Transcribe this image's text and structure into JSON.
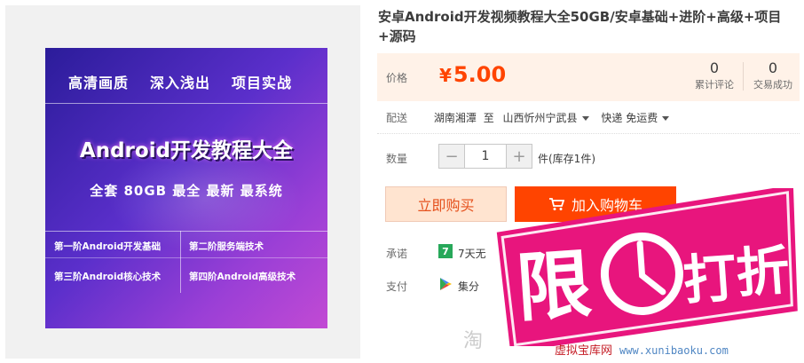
{
  "poster": {
    "tags": [
      "高清画质",
      "深入浅出",
      "项目实战"
    ],
    "title": "Android开发教程大全",
    "subtitle": "全套 80GB  最全 最新 最系统",
    "stages": [
      "第一阶Android开发基础",
      "第二阶服务端技术",
      "第三阶Android核心技术",
      "第四阶Android高级技术"
    ]
  },
  "product": {
    "title": "安卓Android开发视频教程大全50GB/安卓基础+进阶+高级+项目+源码"
  },
  "price": {
    "label": "价格",
    "currency": "¥",
    "value": "5.00",
    "reviews_count": "0",
    "reviews_label": "累计评论",
    "sales_count": "0",
    "sales_label": "交易成功"
  },
  "shipping": {
    "label": "配送",
    "from": "湖南湘潭",
    "to_word": "至",
    "destination": "山西忻州宁武县",
    "method": "快递 免运费"
  },
  "quantity": {
    "label": "数量",
    "minus": "−",
    "value": "1",
    "plus": "+",
    "stock": "件(库存1件)"
  },
  "actions": {
    "buy_now": "立即购买",
    "add_to_cart": "加入购物车"
  },
  "promise": {
    "label": "承诺",
    "icon_text": "7",
    "text": "7天无"
  },
  "payment": {
    "label": "支付",
    "text": "集分"
  },
  "promo": {
    "badge_char_1": "限",
    "badge_char_2": "打",
    "badge_char_3": "折",
    "site_name": "虚拟宝库网",
    "site_url": "www.xunibaoku.com",
    "watermark": "淘"
  },
  "colors": {
    "accent": "#ff4400",
    "promo_pink": "#e8157d"
  }
}
